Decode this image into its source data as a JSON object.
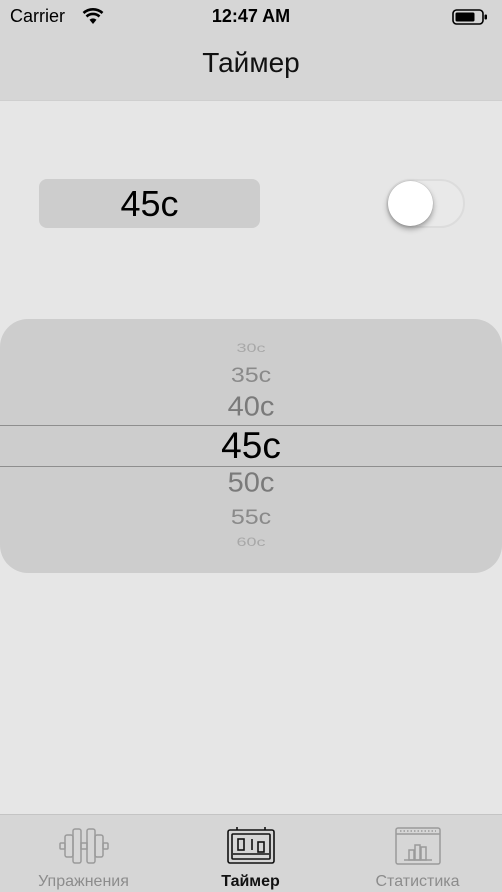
{
  "status_bar": {
    "carrier": "Carrier",
    "time": "12:47 AM",
    "wifi_icon": "wifi-icon",
    "battery_icon": "battery-icon"
  },
  "nav": {
    "title": "Таймер"
  },
  "timer": {
    "display_value": "45с",
    "toggle_on": false
  },
  "picker": {
    "options": [
      "30с",
      "35с",
      "40с",
      "45с",
      "50с",
      "55с",
      "60с"
    ],
    "selected": "45с"
  },
  "tab_bar": {
    "items": [
      {
        "label": "Упражнения",
        "icon": "dumbbell-icon",
        "active": false
      },
      {
        "label": "Таймер",
        "icon": "timer-clock-icon",
        "active": true
      },
      {
        "label": "Статистика",
        "icon": "bar-chart-icon",
        "active": false
      }
    ]
  },
  "colors": {
    "background": "#e6e6e6",
    "bars": "#d6d6d6",
    "control_fill": "#cdcdcd",
    "inactive_tab": "#8c8c8c"
  }
}
